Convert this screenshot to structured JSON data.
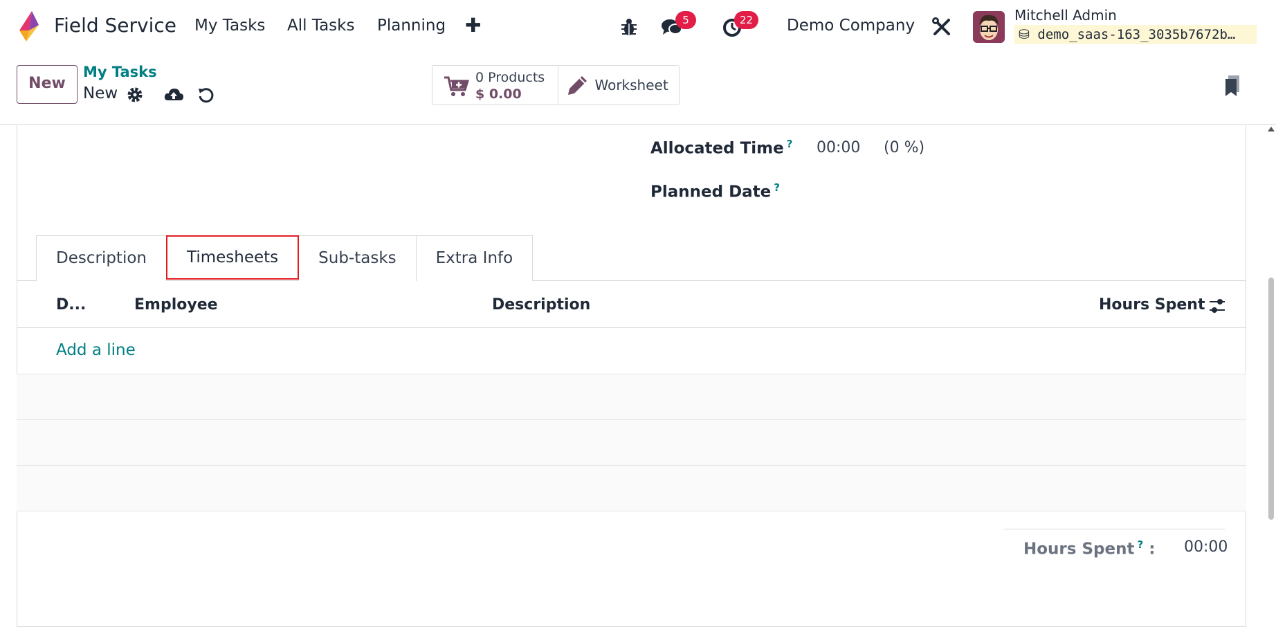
{
  "navbar": {
    "app_name": "Field Service",
    "menu": [
      "My Tasks",
      "All Tasks",
      "Planning"
    ],
    "messages_count": "5",
    "activities_count": "22",
    "company": "Demo Company",
    "user_name": "Mitchell Admin",
    "database": "demo_saas-163_3035b7672b…"
  },
  "control": {
    "new_label": "New",
    "breadcrumb_parent": "My Tasks",
    "breadcrumb_current": "New",
    "products_count": "0 Products",
    "products_price": "$ 0.00",
    "worksheet_label": "Worksheet"
  },
  "fields": {
    "allocated_time_label": "Allocated Time",
    "allocated_time_value": "00:00",
    "allocated_time_percent": "(0 %)",
    "planned_date_label": "Planned Date",
    "help_mark": "?"
  },
  "tabs": [
    "Description",
    "Timesheets",
    "Sub-tasks",
    "Extra Info"
  ],
  "timesheet_table": {
    "columns": [
      "D...",
      "Employee",
      "Description",
      "Hours Spent"
    ],
    "add_line": "Add a line",
    "total_label": "Hours Spent",
    "total_colon": ":",
    "total_value": "00:00"
  },
  "colors": {
    "brand": "#714b67",
    "accent": "#017e84",
    "badge": "#e11d48",
    "highlight": "#e11d24"
  }
}
